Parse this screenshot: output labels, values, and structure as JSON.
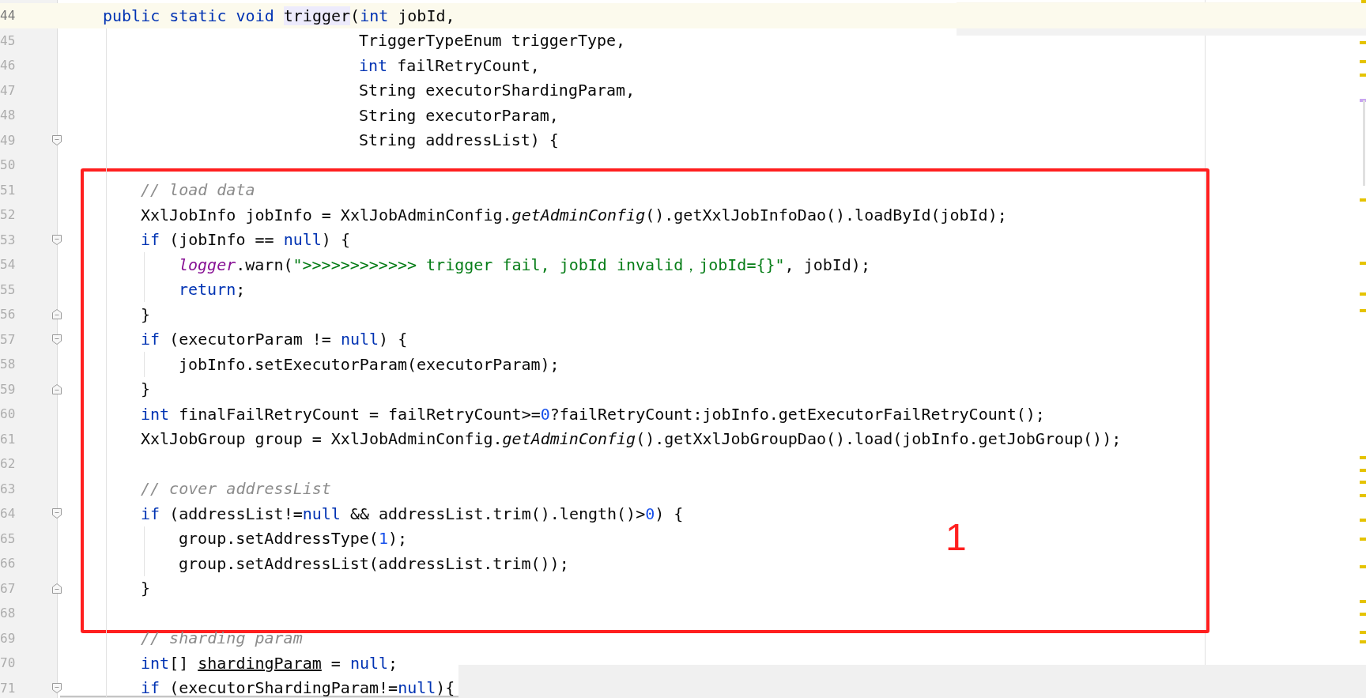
{
  "editor": {
    "lines": [
      {
        "number": "44",
        "current": true,
        "kind": "signature",
        "block_start": false,
        "block_end": false,
        "tokens": [
          {
            "kind": "keyword",
            "text": "public static void "
          },
          {
            "kind": "highlight",
            "text": "trigger"
          },
          {
            "kind": "plain",
            "text": "("
          },
          {
            "kind": "keyword",
            "text": "int"
          },
          {
            "kind": "plain",
            "text": " jobId,"
          }
        ]
      },
      {
        "number": "45",
        "current": false,
        "kind": "parameter",
        "block_start": false,
        "block_end": false,
        "tokens": [
          {
            "kind": "plain",
            "text": "TriggerTypeEnum triggerType,"
          }
        ]
      },
      {
        "number": "46",
        "current": false,
        "kind": "parameter",
        "block_start": false,
        "block_end": false,
        "tokens": [
          {
            "kind": "keyword",
            "text": "int"
          },
          {
            "kind": "plain",
            "text": " failRetryCount,"
          }
        ]
      },
      {
        "number": "47",
        "current": false,
        "kind": "parameter",
        "block_start": false,
        "block_end": false,
        "tokens": [
          {
            "kind": "plain",
            "text": "String executorShardingParam,"
          }
        ]
      },
      {
        "number": "48",
        "current": false,
        "kind": "parameter",
        "block_start": false,
        "block_end": false,
        "tokens": [
          {
            "kind": "plain",
            "text": "String executorParam,"
          }
        ]
      },
      {
        "number": "49",
        "current": false,
        "kind": "parameter",
        "block_start": true,
        "block_end": false,
        "tokens": [
          {
            "kind": "plain",
            "text": "String addressList) {"
          }
        ]
      },
      {
        "number": "50",
        "current": false,
        "kind": "blank",
        "block_start": false,
        "block_end": false
      },
      {
        "number": "51",
        "current": false,
        "kind": "statement",
        "block_start": false,
        "block_end": false,
        "tokens": [
          {
            "kind": "comment",
            "text": "// load data"
          }
        ]
      },
      {
        "number": "52",
        "current": false,
        "kind": "statement",
        "block_start": false,
        "block_end": false,
        "tokens": [
          {
            "kind": "plain",
            "text": "XxlJobInfo jobInfo = XxlJobAdminConfig."
          },
          {
            "kind": "static-method",
            "text": "getAdminConfig"
          },
          {
            "kind": "plain",
            "text": "().getXxlJobInfoDao().loadById(jobId);"
          }
        ]
      },
      {
        "number": "53",
        "current": false,
        "kind": "statement",
        "block_start": true,
        "block_end": false,
        "tokens": [
          {
            "kind": "keyword",
            "text": "if"
          },
          {
            "kind": "plain",
            "text": " (jobInfo == "
          },
          {
            "kind": "keyword",
            "text": "null"
          },
          {
            "kind": "plain",
            "text": ") {"
          }
        ]
      },
      {
        "number": "54",
        "current": false,
        "kind": "nested",
        "block_start": false,
        "block_end": false,
        "tokens": [
          {
            "kind": "static-field",
            "text": "logger"
          },
          {
            "kind": "plain",
            "text": ".warn("
          },
          {
            "kind": "string",
            "text": "\">>>>>>>>>>>> trigger fail, jobId invalid，jobId={}\""
          },
          {
            "kind": "plain",
            "text": ", jobId);"
          }
        ]
      },
      {
        "number": "55",
        "current": false,
        "kind": "nested",
        "block_start": false,
        "block_end": false,
        "tokens": [
          {
            "kind": "keyword",
            "text": "return"
          },
          {
            "kind": "plain",
            "text": ";"
          }
        ]
      },
      {
        "number": "56",
        "current": false,
        "kind": "statement",
        "block_start": false,
        "block_end": true,
        "tokens": [
          {
            "kind": "plain",
            "text": "}"
          }
        ]
      },
      {
        "number": "57",
        "current": false,
        "kind": "statement",
        "block_start": true,
        "block_end": false,
        "tokens": [
          {
            "kind": "keyword",
            "text": "if"
          },
          {
            "kind": "plain",
            "text": " (executorParam != "
          },
          {
            "kind": "keyword",
            "text": "null"
          },
          {
            "kind": "plain",
            "text": ") {"
          }
        ]
      },
      {
        "number": "58",
        "current": false,
        "kind": "nested",
        "block_start": false,
        "block_end": false,
        "tokens": [
          {
            "kind": "plain",
            "text": "jobInfo.setExecutorParam(executorParam);"
          }
        ]
      },
      {
        "number": "59",
        "current": false,
        "kind": "statement",
        "block_start": false,
        "block_end": true,
        "tokens": [
          {
            "kind": "plain",
            "text": "}"
          }
        ]
      },
      {
        "number": "60",
        "current": false,
        "kind": "statement",
        "block_start": false,
        "block_end": false,
        "tokens": [
          {
            "kind": "keyword",
            "text": "int"
          },
          {
            "kind": "plain",
            "text": " finalFailRetryCount = failRetryCount>="
          },
          {
            "kind": "number",
            "text": "0"
          },
          {
            "kind": "plain",
            "text": "?failRetryCount:jobInfo.getExecutorFailRetryCount();"
          }
        ]
      },
      {
        "number": "61",
        "current": false,
        "kind": "statement",
        "block_start": false,
        "block_end": false,
        "tokens": [
          {
            "kind": "plain",
            "text": "XxlJobGroup group = XxlJobAdminConfig."
          },
          {
            "kind": "static-method",
            "text": "getAdminConfig"
          },
          {
            "kind": "plain",
            "text": "().getXxlJobGroupDao().load(jobInfo.getJobGroup());"
          }
        ]
      },
      {
        "number": "62",
        "current": false,
        "kind": "blank",
        "block_start": false,
        "block_end": false
      },
      {
        "number": "63",
        "current": false,
        "kind": "statement",
        "block_start": false,
        "block_end": false,
        "tokens": [
          {
            "kind": "comment",
            "text": "// cover addressList"
          }
        ]
      },
      {
        "number": "64",
        "current": false,
        "kind": "statement",
        "block_start": true,
        "block_end": false,
        "tokens": [
          {
            "kind": "keyword",
            "text": "if"
          },
          {
            "kind": "plain",
            "text": " (addressList!="
          },
          {
            "kind": "keyword",
            "text": "null"
          },
          {
            "kind": "plain",
            "text": " && addressList.trim().length()>"
          },
          {
            "kind": "number",
            "text": "0"
          },
          {
            "kind": "plain",
            "text": ") {"
          }
        ]
      },
      {
        "number": "65",
        "current": false,
        "kind": "nested",
        "block_start": false,
        "block_end": false,
        "tokens": [
          {
            "kind": "plain",
            "text": "group.setAddressType("
          },
          {
            "kind": "number",
            "text": "1"
          },
          {
            "kind": "plain",
            "text": ");"
          }
        ]
      },
      {
        "number": "66",
        "current": false,
        "kind": "nested",
        "block_start": false,
        "block_end": false,
        "tokens": [
          {
            "kind": "plain",
            "text": "group.setAddressList(addressList.trim());"
          }
        ]
      },
      {
        "number": "67",
        "current": false,
        "kind": "statement",
        "block_start": false,
        "block_end": true,
        "tokens": [
          {
            "kind": "plain",
            "text": "}"
          }
        ]
      },
      {
        "number": "68",
        "current": false,
        "kind": "blank",
        "block_start": false,
        "block_end": false
      },
      {
        "number": "69",
        "current": false,
        "kind": "statement",
        "block_start": false,
        "block_end": false,
        "tokens": [
          {
            "kind": "comment",
            "text": "// sharding param"
          }
        ]
      },
      {
        "number": "70",
        "current": false,
        "kind": "statement",
        "block_start": false,
        "block_end": false,
        "tokens": [
          {
            "kind": "keyword",
            "text": "int"
          },
          {
            "kind": "plain",
            "text": "[] "
          },
          {
            "kind": "reassigned",
            "text": "shardingParam"
          },
          {
            "kind": "plain",
            "text": " = "
          },
          {
            "kind": "keyword",
            "text": "null"
          },
          {
            "kind": "plain",
            "text": ";"
          }
        ]
      },
      {
        "number": "71",
        "current": false,
        "kind": "statement",
        "block_start": true,
        "block_end": false,
        "tokens": [
          {
            "kind": "keyword",
            "text": "if"
          },
          {
            "kind": "plain",
            "text": " (executorShardingParam!="
          },
          {
            "kind": "keyword",
            "text": "null"
          },
          {
            "kind": "plain",
            "text": "){"
          }
        ]
      }
    ]
  },
  "annotation": {
    "label": "1"
  }
}
